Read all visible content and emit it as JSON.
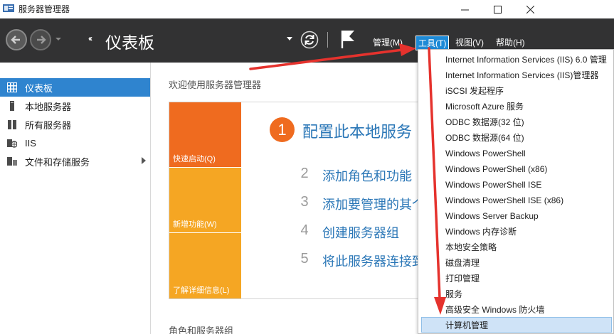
{
  "window": {
    "title": "服务器管理器",
    "minimize_glyph": "—",
    "maximize_glyph": "☐",
    "close_glyph": "✕"
  },
  "header": {
    "breadcrumb_chevron": "‹‹",
    "page_title": "仪表板",
    "menus": [
      {
        "label": "管理(M)"
      },
      {
        "label": "工具(T)"
      },
      {
        "label": "视图(V)"
      },
      {
        "label": "帮助(H)"
      }
    ]
  },
  "sidebar": {
    "items": [
      {
        "label": "仪表板",
        "icon": "dashboard-icon",
        "active": true
      },
      {
        "label": "本地服务器",
        "icon": "server-icon"
      },
      {
        "label": "所有服务器",
        "icon": "servers-icon"
      },
      {
        "label": "IIS",
        "icon": "iis-icon"
      },
      {
        "label": "文件和存储服务",
        "icon": "storage-icon",
        "has_children": true
      }
    ]
  },
  "main": {
    "welcome_label": "欢迎使用服务器管理器",
    "tiles": [
      {
        "label": "快速启动(Q)"
      },
      {
        "label": "新增功能(W)"
      },
      {
        "label": "了解详细信息(L)"
      }
    ],
    "steps": [
      {
        "number": "1",
        "text": "配置此本地服务"
      },
      {
        "number": "2",
        "text": "添加角色和功能"
      },
      {
        "number": "3",
        "text": "添加要管理的其个"
      },
      {
        "number": "4",
        "text": "创建服务器组"
      },
      {
        "number": "5",
        "text": "将此服务器连接致"
      }
    ],
    "roles_label": "角色和服务器组"
  },
  "tools_menu": {
    "items": [
      {
        "label": "Internet Information Services (IIS) 6.0 管理"
      },
      {
        "label": "Internet Information Services (IIS)管理器"
      },
      {
        "label": "iSCSI 发起程序"
      },
      {
        "label": "Microsoft Azure 服务"
      },
      {
        "label": "ODBC 数据源(32 位)"
      },
      {
        "label": "ODBC 数据源(64 位)"
      },
      {
        "label": "Windows PowerShell"
      },
      {
        "label": "Windows PowerShell (x86)"
      },
      {
        "label": "Windows PowerShell ISE"
      },
      {
        "label": "Windows PowerShell ISE (x86)"
      },
      {
        "label": "Windows Server Backup"
      },
      {
        "label": "Windows 内存诊断"
      },
      {
        "label": "本地安全策略"
      },
      {
        "label": "磁盘清理"
      },
      {
        "label": "打印管理"
      },
      {
        "label": "服务"
      },
      {
        "label": "高级安全 Windows 防火墙"
      },
      {
        "label": "计算机管理",
        "highlighted": true
      }
    ]
  },
  "colors": {
    "header_bg": "#323233",
    "accent_blue": "#2f84cf",
    "orange": "#ef6b1f",
    "amber": "#f5a623",
    "annotation_red": "#e5322d"
  }
}
